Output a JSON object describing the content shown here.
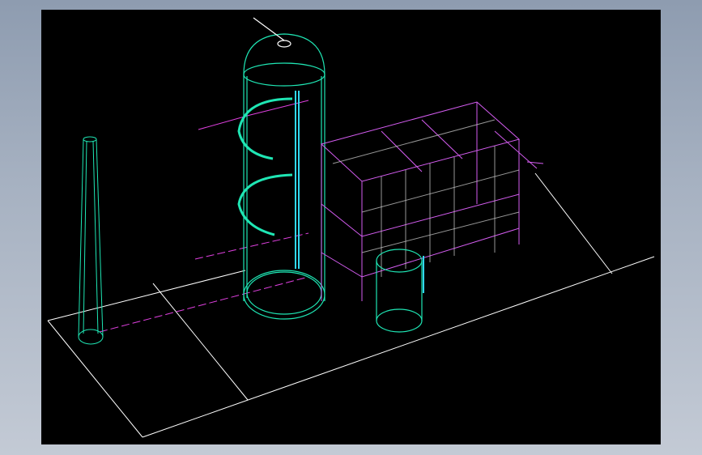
{
  "viewport": {
    "background": "#000000",
    "colors": {
      "base_outline": "#ffffff",
      "vessel": "#1fe6b4",
      "steel_frame": "#d45cf0",
      "frame_light": "#c8c8c8",
      "pipe": "#e040e0",
      "ladder": "#30d8f0"
    },
    "objects": [
      "chimney-stack",
      "absorption-tower",
      "spiral-platform",
      "steel-frame-structure",
      "small-tank",
      "duct-pipe",
      "foundation-slab"
    ]
  }
}
